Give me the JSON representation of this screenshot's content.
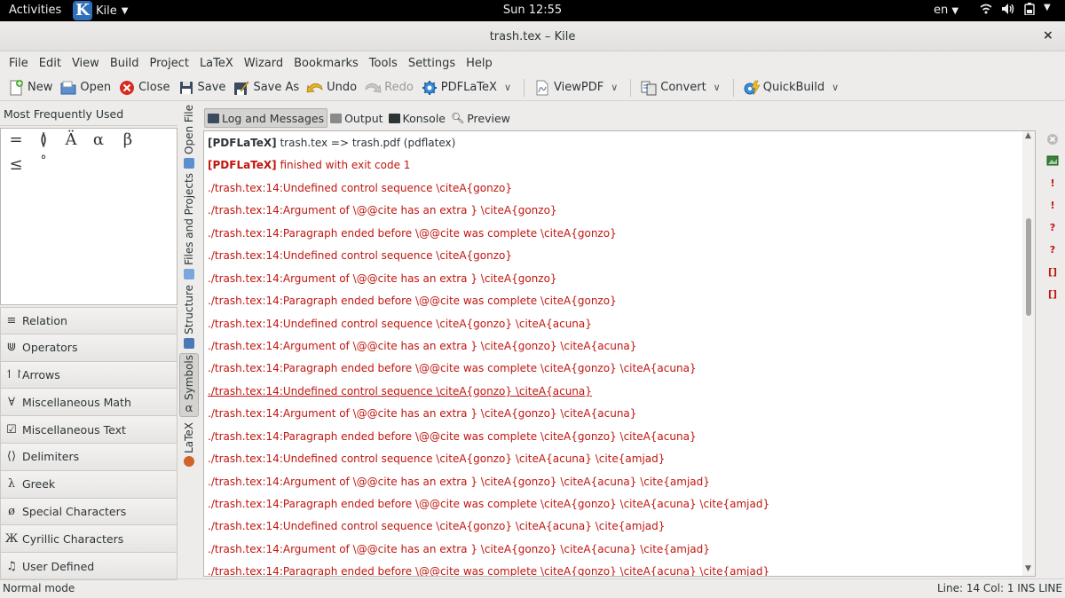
{
  "topbar": {
    "activities": "Activities",
    "app_name": "Kile",
    "app_letter": "K",
    "clock": "Sun 12:55",
    "lang": "en"
  },
  "window": {
    "title": "trash.tex – Kile",
    "close": "×"
  },
  "menu": [
    "File",
    "Edit",
    "View",
    "Build",
    "Project",
    "LaTeX",
    "Wizard",
    "Bookmarks",
    "Tools",
    "Settings",
    "Help"
  ],
  "toolbar": {
    "new": "New",
    "open": "Open",
    "close": "Close",
    "save": "Save",
    "save_as": "Save As",
    "undo": "Undo",
    "redo": "Redo",
    "pdflatex": "PDFLaTeX",
    "viewpdf": "ViewPDF",
    "convert": "Convert",
    "quickbuild": "QuickBuild"
  },
  "left_panel": {
    "header": "Most Frequently Used",
    "symbols": [
      "=",
      "≬",
      "Ä",
      "α",
      "β",
      "≤",
      "°"
    ],
    "categories": [
      {
        "icon": "≡",
        "label": "Relation"
      },
      {
        "icon": "⋓",
        "label": "Operators"
      },
      {
        "icon": "↿↾",
        "label": "Arrows"
      },
      {
        "icon": "∀",
        "label": "Miscellaneous Math"
      },
      {
        "icon": "☑",
        "label": "Miscellaneous Text"
      },
      {
        "icon": "⟨⟩",
        "label": "Delimiters"
      },
      {
        "icon": "λ",
        "label": "Greek"
      },
      {
        "icon": "ø",
        "label": "Special Characters"
      },
      {
        "icon": "Ж",
        "label": "Cyrillic Characters"
      },
      {
        "icon": "♫",
        "label": "User Defined"
      }
    ]
  },
  "vertical_tabs": {
    "open_file": "Open File",
    "files_projects": "Files and Projects",
    "structure": "Structure",
    "symbols": "Symbols",
    "latex": "LaTeX"
  },
  "dock_tabs": {
    "log": "Log and Messages",
    "output": "Output",
    "konsole": "Konsole",
    "preview": "Preview"
  },
  "log": {
    "line0_tag": "[PDFLaTeX]",
    "line0_text": " trash.tex => trash.pdf (pdflatex)",
    "line1_tag": "[PDFLaTeX]",
    "line1_text": " finished with exit code 1",
    "errors": [
      "./trash.tex:14:Undefined control sequence \\citeA{gonzo}",
      "./trash.tex:14:Argument of \\@@cite has an extra } \\citeA{gonzo}",
      "./trash.tex:14:Paragraph ended before \\@@cite was complete \\citeA{gonzo}",
      "./trash.tex:14:Undefined control sequence \\citeA{gonzo}",
      "./trash.tex:14:Argument of \\@@cite has an extra } \\citeA{gonzo}",
      "./trash.tex:14:Paragraph ended before \\@@cite was complete \\citeA{gonzo}",
      "./trash.tex:14:Undefined control sequence \\citeA{gonzo} \\citeA{acuna}",
      "./trash.tex:14:Argument of \\@@cite has an extra } \\citeA{gonzo} \\citeA{acuna}",
      "./trash.tex:14:Paragraph ended before \\@@cite was complete \\citeA{gonzo} \\citeA{acuna}",
      "./trash.tex:14:Undefined control sequence \\citeA{gonzo} \\citeA{acuna}",
      "./trash.tex:14:Argument of \\@@cite has an extra } \\citeA{gonzo} \\citeA{acuna}",
      "./trash.tex:14:Paragraph ended before \\@@cite was complete \\citeA{gonzo} \\citeA{acuna}",
      "./trash.tex:14:Undefined control sequence \\citeA{gonzo} \\citeA{acuna} \\cite{amjad}",
      "./trash.tex:14:Argument of \\@@cite has an extra } \\citeA{gonzo} \\citeA{acuna} \\cite{amjad}",
      "./trash.tex:14:Paragraph ended before \\@@cite was complete \\citeA{gonzo} \\citeA{acuna} \\cite{amjad}",
      "./trash.tex:14:Undefined control sequence \\citeA{gonzo} \\citeA{acuna} \\cite{amjad}",
      "./trash.tex:14:Argument of \\@@cite has an extra } \\citeA{gonzo} \\citeA{acuna} \\cite{amjad}",
      "./trash.tex:14:Paragraph ended before \\@@cite was complete \\citeA{gonzo} \\citeA{acuna} \\cite{amjad}"
    ]
  },
  "status": {
    "mode": "Normal mode",
    "position": "Line: 14 Col: 1  INS  LINE"
  },
  "colors": {
    "error": "#c0150f",
    "accent": "#2d6fb8"
  }
}
